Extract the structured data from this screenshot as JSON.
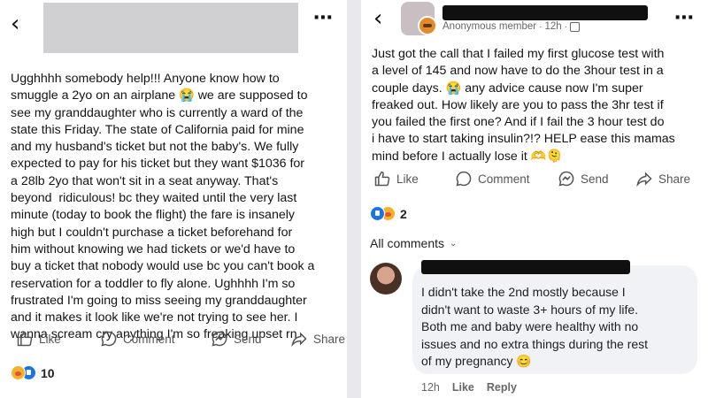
{
  "left_post": {
    "body": "Ugghhhh somebody help!!! Anyone know how to\nsmuggle a 2yo on an airplane 😭 we are supposed to\nsee my granddaughter who is currently a ward of the\nstate this Friday. The state of California paid for mine\nand my husband's ticket but not the baby's. We fully\nexpected to pay for his ticket but they want $1036 for\na 28lb 2yo that won't sit in a seat anyway. That's\nbeyond  ridiculous! bc they waited until the very last\nminute (today to book the flight) the fare is insanely\nhigh but I couldn't purchase a ticket beforehand for\nhim without knowing we had tickets or we'd have to\nbuy a ticket that nobody would use bc you can't book a\nreservation for a toddler to fly alone. Ughhhh I'm so\nfrustrated I'm going to miss seeing my granddaughter\nand it makes it look like we're not trying to see her. I\nwanna scream cry anything I'm so freaking upset rn",
    "actions": {
      "like": "Like",
      "comment": "Comment",
      "send": "Send",
      "share": "Share"
    },
    "reaction_count": "10"
  },
  "right_post": {
    "author_label": "Anonymous member",
    "time": "12h",
    "body": "Just got the call that I failed my first glucose test with\na level of 145 and now have to do the 3hour test in a\ncouple days. 😭 any advice cause now I'm super\nfreaked out. How likely are you to pass the 3hr test if\nyou failed the first one? And if I fail the 3 hour test do\ni have to start taking insulin?!? HELP ease this mamas\nmind before I actually lose it 🫶🫠",
    "actions": {
      "like": "Like",
      "comment": "Comment",
      "send": "Send",
      "share": "Share"
    },
    "reaction_count": "2",
    "all_comments_label": "All comments",
    "comment": {
      "text": "I didn't take the 2nd mostly because I\ndidn't want to waste 3+ hours of my life.\nBoth me and baby were healthy with no\nissues and no extra things during the rest\nof my pregnancy 😊",
      "time": "12h",
      "like_label": "Like",
      "reply_label": "Reply"
    }
  },
  "icons": [
    "back-icon",
    "more-icon",
    "like-icon",
    "comment-icon",
    "send-icon",
    "share-icon",
    "globe-icon",
    "chevron-down-icon"
  ],
  "colors": {
    "background": "#ffffff",
    "separator": "#e9e9ec",
    "redaction": "#101010",
    "like_blue": "#1b74e4",
    "muted_text": "#65676b",
    "comment_bubble": "#f0f2f5"
  }
}
